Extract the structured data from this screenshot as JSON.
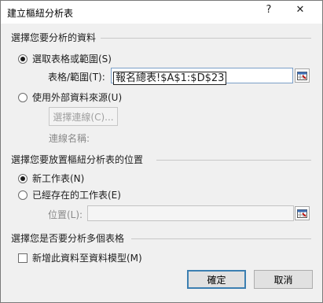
{
  "window": {
    "title": "建立樞紐分析表",
    "help_label": "?",
    "close_label": "✕"
  },
  "choose_data": {
    "heading": "選擇您要分析的資料",
    "option_select": "選取表格或範圍(S)",
    "table_range_label": "表格/範圍(T):",
    "table_range_value": "報名總表!$A$1:$D$23",
    "option_external": "使用外部資料來源(U)",
    "choose_connection_label": "選擇連線(C)...",
    "connection_name_label": "連線名稱:"
  },
  "placement": {
    "heading": "選擇您要放置樞紐分析表的位置",
    "option_new_sheet": "新工作表(N)",
    "option_existing_sheet": "已經存在的工作表(E)",
    "location_label": "位置(L):",
    "location_value": ""
  },
  "multiple_tables": {
    "heading": "選擇您是否要分析多個表格",
    "add_to_model_label": "新增此資料至資料模型(M)"
  },
  "footer": {
    "ok_label": "確定",
    "cancel_label": "取消"
  }
}
